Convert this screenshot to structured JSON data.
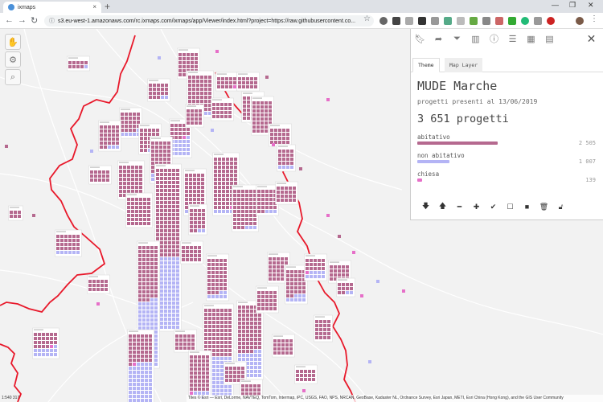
{
  "browser": {
    "tab_title": "ixmaps",
    "url": "s3.eu-west-1.amazonaws.com/rc.ixmaps.com/ixmaps/app/Viewer/index.html?project=https://raw.githubusercontent.co...",
    "new_tab": "+",
    "close_tab": "×",
    "win_min": "—",
    "win_max": "❐",
    "win_close": "✕"
  },
  "panel": {
    "tabs": [
      "Theme",
      "Map Layer"
    ],
    "title": "MUDE Marche",
    "subtitle": "progetti presenti al 13/06/2019",
    "total": "3 651 progetti",
    "categories": [
      {
        "label": "abitativo",
        "value": "2 505",
        "fraction": 0.686,
        "color": "#b5698f"
      },
      {
        "label": "non abitativo",
        "value": "1 007",
        "fraction": 0.276,
        "color": "#b4b4f5"
      },
      {
        "label": "chiesa",
        "value": "139",
        "fraction": 0.038,
        "color": "#e66fc8"
      }
    ],
    "tool_icons": [
      "bookmark-icon",
      "share-icon",
      "filter-icon",
      "map-icon",
      "info-icon",
      "list-icon",
      "table-icon",
      "settings-icon",
      "close-icon"
    ],
    "action_icons": [
      "arrow-down-icon",
      "arrow-up-icon",
      "minus-icon",
      "plus-icon",
      "check-icon",
      "square-outline-icon",
      "square-filled-icon",
      "trash-icon",
      "unlock-icon"
    ]
  },
  "map": {
    "attribution": "Tiles © Esri — Esri, DeLorme, NAVTEQ, TomTom, Intermap, iPC, USGS, FAO, NPS, NRCAN, GeoBase, Kadaster NL, Ordnance Survey, Esri Japan, METI, Esri China (Hong Kong), and the GIS User Community",
    "scale": "1:540 317",
    "colors": {
      "residential": "#b5698f",
      "nonresidential": "#b4b4f5",
      "church": "#e66fc8",
      "border": "#e8182a"
    }
  }
}
